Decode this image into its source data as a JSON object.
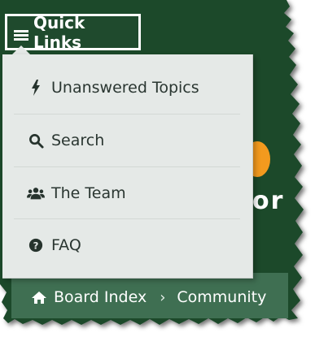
{
  "quick_links": {
    "label": "Quick Links",
    "icon": "hamburger-icon"
  },
  "dropdown": {
    "items": [
      {
        "label": "Unanswered Topics",
        "icon": "bolt-icon"
      },
      {
        "label": "Search",
        "icon": "search-icon"
      },
      {
        "label": "The Team",
        "icon": "users-icon"
      },
      {
        "label": "FAQ",
        "icon": "question-circle-icon"
      }
    ]
  },
  "breadcrumbs": {
    "items": [
      "Board Index",
      "Community"
    ],
    "separator": "›",
    "home_icon": "home-icon"
  },
  "site_title_fragment": "or",
  "colors": {
    "header_bg": "#1e4a2c",
    "navbar_bg": "#3f6f52",
    "dropdown_bg": "#e5e9e7",
    "logo_accent": "#f39a1e",
    "text_dark": "#2a3631"
  }
}
